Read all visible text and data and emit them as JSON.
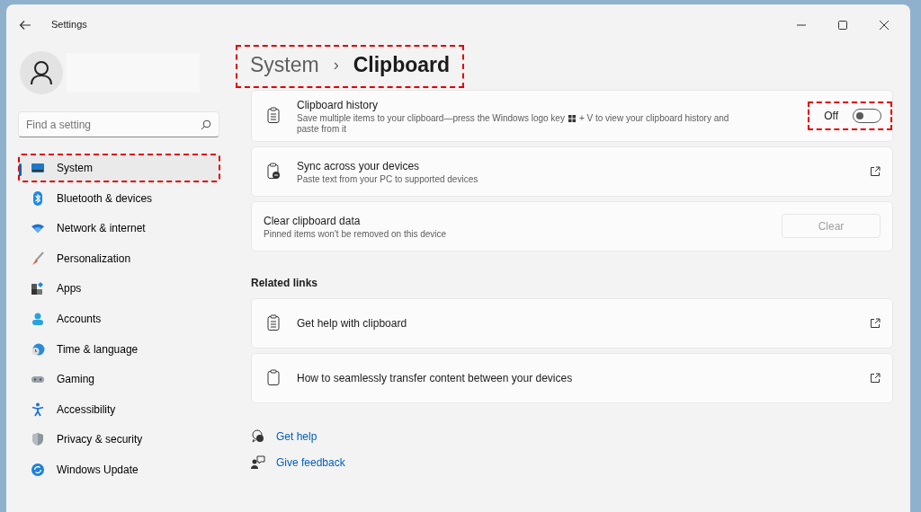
{
  "window": {
    "title": "Settings"
  },
  "sidebar": {
    "search": {
      "placeholder": "Find a setting"
    },
    "items": [
      {
        "label": "System",
        "selected": true,
        "highlighted": true
      },
      {
        "label": "Bluetooth & devices",
        "selected": false,
        "highlighted": false
      },
      {
        "label": "Network & internet",
        "selected": false,
        "highlighted": false
      },
      {
        "label": "Personalization",
        "selected": false,
        "highlighted": false
      },
      {
        "label": "Apps",
        "selected": false,
        "highlighted": false
      },
      {
        "label": "Accounts",
        "selected": false,
        "highlighted": false
      },
      {
        "label": "Time & language",
        "selected": false,
        "highlighted": false
      },
      {
        "label": "Gaming",
        "selected": false,
        "highlighted": false
      },
      {
        "label": "Accessibility",
        "selected": false,
        "highlighted": false
      },
      {
        "label": "Privacy & security",
        "selected": false,
        "highlighted": false
      },
      {
        "label": "Windows Update",
        "selected": false,
        "highlighted": false
      }
    ]
  },
  "breadcrumb": {
    "parent": "System",
    "separator": "›",
    "current": "Clipboard",
    "highlighted": true
  },
  "settings": [
    {
      "kind": "toggle",
      "title": "Clipboard history",
      "description_parts": [
        "Save multiple items to your clipboard—press the Windows logo key",
        "+ V to view your clipboard history and",
        "paste from it"
      ],
      "state_label": "Off",
      "on": false,
      "highlighted": true
    },
    {
      "kind": "link",
      "title": "Sync across your devices",
      "description": "Paste text from your PC to supported devices"
    },
    {
      "kind": "button",
      "title": "Clear clipboard data",
      "description": "Pinned items won't be removed on this device",
      "button": {
        "label": "Clear",
        "disabled": true
      }
    }
  ],
  "related_links": {
    "heading": "Related links",
    "items": [
      {
        "label": "Get help with clipboard"
      },
      {
        "label": "How to seamlessly transfer content between your devices"
      }
    ]
  },
  "footer_links": [
    {
      "label": "Get help"
    },
    {
      "label": "Give feedback"
    }
  ]
}
